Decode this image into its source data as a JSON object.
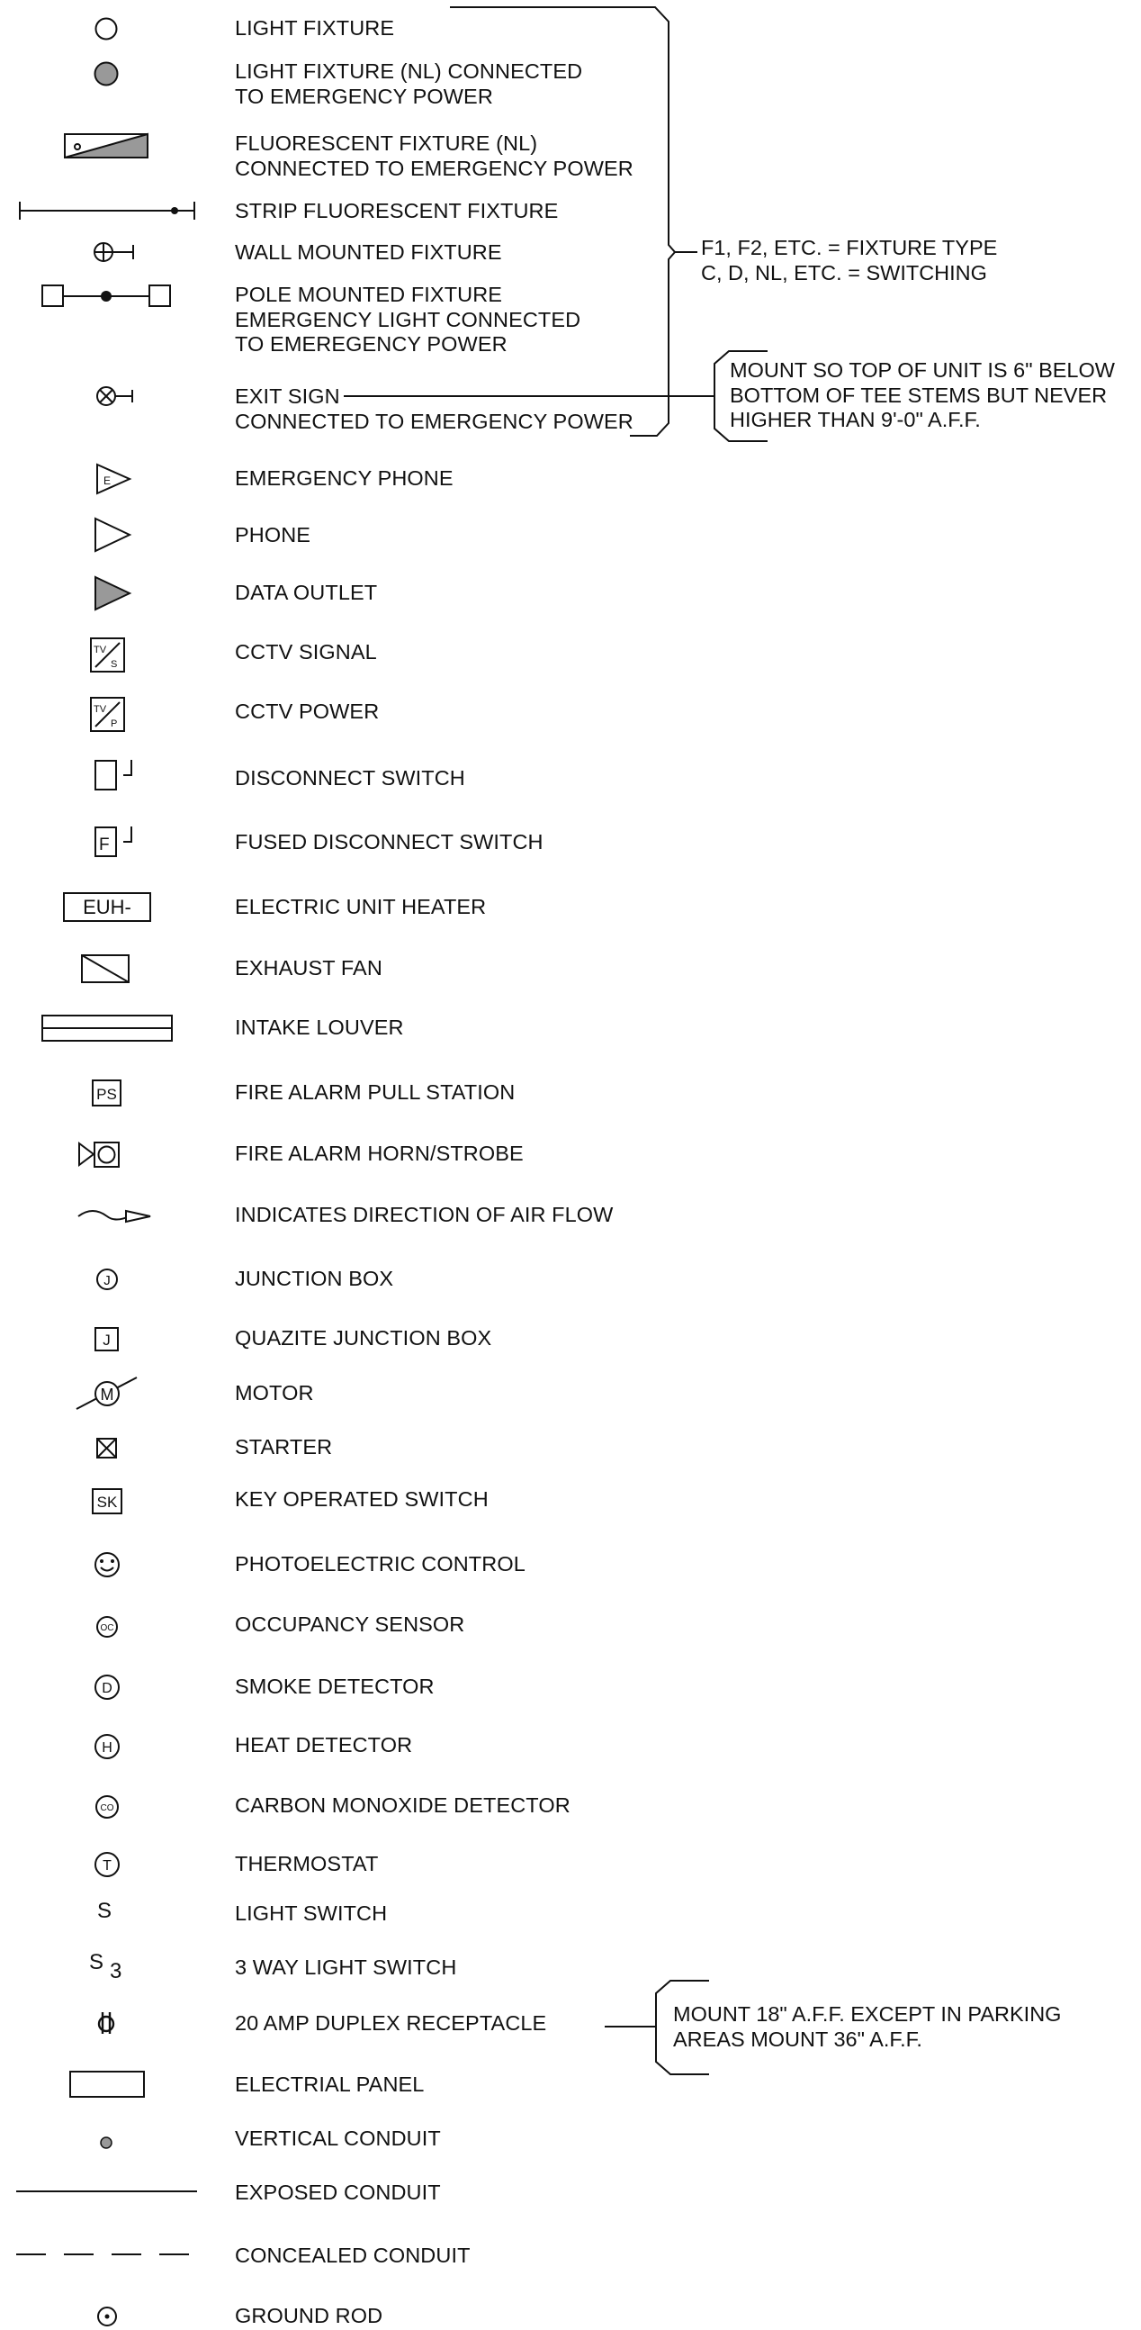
{
  "legend": [
    {
      "symbol": "light-fixture",
      "lines": [
        "LIGHT FIXTURE"
      ]
    },
    {
      "symbol": "light-fixture-nl",
      "lines": [
        "LIGHT FIXTURE (NL) CONNECTED",
        "TO EMERGENCY POWER"
      ]
    },
    {
      "symbol": "fluorescent-fixture-nl",
      "lines": [
        "FLUORESCENT FIXTURE (NL)",
        "CONNECTED TO EMERGENCY POWER"
      ]
    },
    {
      "symbol": "strip-fluorescent-fixture",
      "lines": [
        "STRIP FLUORESCENT FIXTURE"
      ]
    },
    {
      "symbol": "wall-mounted-fixture",
      "lines": [
        "WALL MOUNTED FIXTURE"
      ]
    },
    {
      "symbol": "pole-mounted-fixture",
      "lines": [
        "POLE MOUNTED FIXTURE",
        "EMERGENCY LIGHT CONNECTED",
        "TO EMEREGENCY POWER"
      ]
    },
    {
      "symbol": "exit-sign",
      "lines": [
        "EXIT SIGN",
        "CONNECTED TO EMERGENCY POWER"
      ]
    },
    {
      "symbol": "emergency-phone",
      "lines": [
        "EMERGENCY PHONE"
      ]
    },
    {
      "symbol": "phone",
      "lines": [
        "PHONE"
      ]
    },
    {
      "symbol": "data-outlet",
      "lines": [
        "DATA OUTLET"
      ]
    },
    {
      "symbol": "cctv-signal",
      "lines": [
        "CCTV SIGNAL"
      ]
    },
    {
      "symbol": "cctv-power",
      "lines": [
        "CCTV POWER"
      ]
    },
    {
      "symbol": "disconnect-switch",
      "lines": [
        "DISCONNECT SWITCH"
      ]
    },
    {
      "symbol": "fused-disconnect-switch",
      "lines": [
        "FUSED DISCONNECT SWITCH"
      ]
    },
    {
      "symbol": "electric-unit-heater",
      "lines": [
        "ELECTRIC UNIT HEATER"
      ]
    },
    {
      "symbol": "exhaust-fan",
      "lines": [
        "EXHAUST FAN"
      ]
    },
    {
      "symbol": "intake-louver",
      "lines": [
        "INTAKE LOUVER"
      ]
    },
    {
      "symbol": "fire-alarm-pull-station",
      "lines": [
        "FIRE ALARM PULL STATION"
      ]
    },
    {
      "symbol": "fire-alarm-horn-strobe",
      "lines": [
        "FIRE ALARM HORN/STROBE"
      ]
    },
    {
      "symbol": "air-flow-direction",
      "lines": [
        "INDICATES DIRECTION OF AIR FLOW"
      ]
    },
    {
      "symbol": "junction-box",
      "lines": [
        "JUNCTION BOX"
      ]
    },
    {
      "symbol": "quazite-junction-box",
      "lines": [
        "QUAZITE JUNCTION BOX"
      ]
    },
    {
      "symbol": "motor",
      "lines": [
        "MOTOR"
      ]
    },
    {
      "symbol": "starter",
      "lines": [
        "STARTER"
      ]
    },
    {
      "symbol": "key-operated-switch",
      "lines": [
        "KEY OPERATED SWITCH"
      ]
    },
    {
      "symbol": "photoelectric-control",
      "lines": [
        "PHOTOELECTRIC CONTROL"
      ]
    },
    {
      "symbol": "occupancy-sensor",
      "lines": [
        "OCCUPANCY SENSOR"
      ]
    },
    {
      "symbol": "smoke-detector",
      "lines": [
        "SMOKE DETECTOR"
      ]
    },
    {
      "symbol": "heat-detector",
      "lines": [
        "HEAT DETECTOR"
      ]
    },
    {
      "symbol": "carbon-monoxide-detector",
      "lines": [
        "CARBON MONOXIDE DETECTOR"
      ]
    },
    {
      "symbol": "thermostat",
      "lines": [
        "THERMOSTAT"
      ]
    },
    {
      "symbol": "light-switch",
      "lines": [
        "LIGHT SWITCH"
      ]
    },
    {
      "symbol": "three-way-light-switch",
      "lines": [
        "3 WAY LIGHT SWITCH"
      ]
    },
    {
      "symbol": "duplex-receptacle",
      "lines": [
        "20 AMP DUPLEX RECEPTACLE"
      ]
    },
    {
      "symbol": "electrical-panel",
      "lines": [
        "ELECTRIAL PANEL"
      ]
    },
    {
      "symbol": "vertical-conduit",
      "lines": [
        "VERTICAL CONDUIT"
      ]
    },
    {
      "symbol": "exposed-conduit",
      "lines": [
        "EXPOSED CONDUIT"
      ]
    },
    {
      "symbol": "concealed-conduit",
      "lines": [
        "CONCEALED CONDUIT"
      ]
    },
    {
      "symbol": "ground-rod",
      "lines": [
        "GROUND ROD"
      ]
    }
  ],
  "symbol_text": {
    "tv_s_top": "TV",
    "tv_s_bottom": "S",
    "tv_p_top": "TV",
    "tv_p_bottom": "P",
    "emergency_phone_letter": "E",
    "fused_letter": "F",
    "heater_label": "EUH-",
    "pull_station_label": "PS",
    "junction_letter": "J",
    "quazite_letter": "J",
    "motor_letter": "M",
    "key_switch_label": "SK",
    "occupancy_label": "OC",
    "smoke_letter": "D",
    "heat_letter": "H",
    "co_label": "CO",
    "thermostat_letter": "T",
    "switch_letter": "S",
    "three_way_letter": "S",
    "three_way_sub": "3"
  },
  "notes": {
    "fixture_note": [
      "F1, F2, ETC. = FIXTURE TYPE",
      "C, D, NL, ETC. = SWITCHING"
    ],
    "exit_note": [
      "MOUNT SO TOP OF UNIT IS 6\" BELOW",
      "BOTTOM OF TEE STEMS BUT NEVER",
      "HIGHER THAN 9'-0\" A.F.F."
    ],
    "receptacle_note": [
      "MOUNT  18\" A.F.F. EXCEPT IN PARKING",
      "AREAS MOUNT 36\" A.F.F."
    ]
  }
}
